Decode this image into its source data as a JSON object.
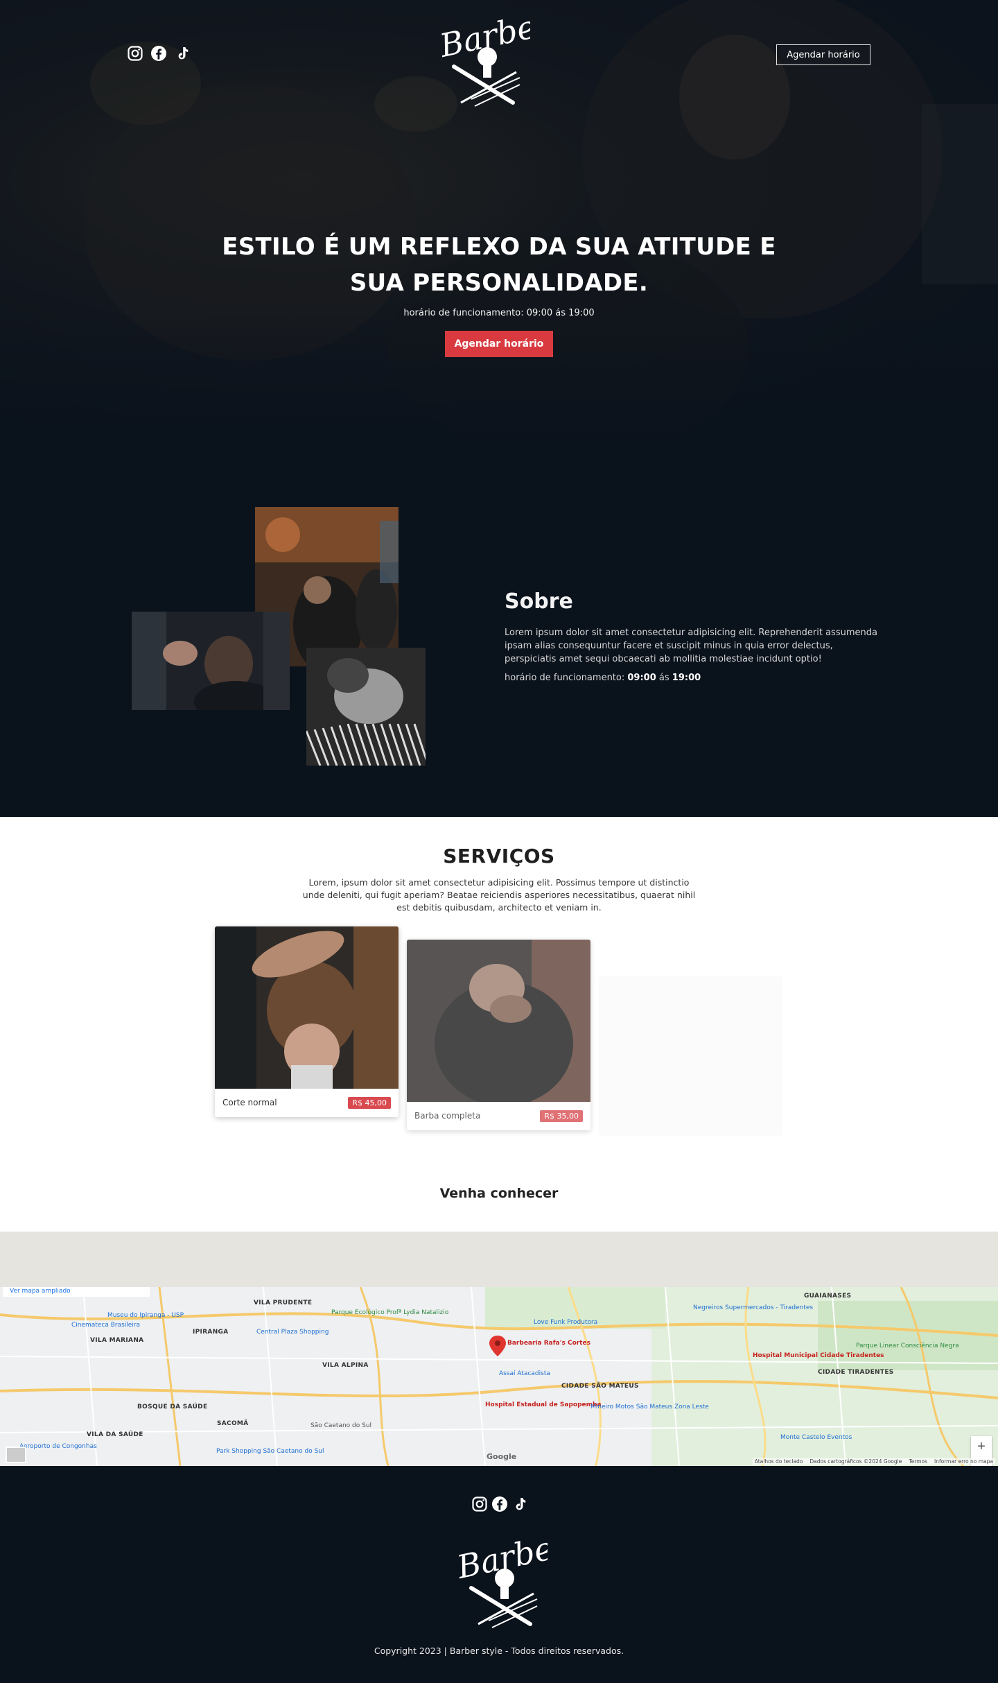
{
  "header": {
    "logo_text": "Barber",
    "cta_label": "Agendar horário",
    "socials": [
      "instagram-icon",
      "facebook-icon",
      "tiktok-icon"
    ]
  },
  "hero": {
    "title_line1": "ESTILO É UM REFLEXO DA SUA ATITUDE E",
    "title_line2": "SUA PERSONALIDADE.",
    "hours": "horário de funcionamento: 09:00 ás 19:00",
    "cta_label": "Agendar horário"
  },
  "about": {
    "title": "Sobre",
    "body": "Lorem ipsum dolor sit amet consectetur adipisicing elit. Reprehenderit assumenda ipsam alias consequuntur facere et suscipit minus in quia error delectus, perspiciatis amet sequi obcaecati ab mollitia molestiae incidunt optio!",
    "hours_prefix": "horário de funcionamento: ",
    "hours_open": "09:00",
    "hours_sep": " ás ",
    "hours_close": "19:00"
  },
  "services": {
    "title": "SERVIÇOS",
    "description": "Lorem, ipsum dolor sit amet consectetur adipisicing elit. Possimus tempore ut distinctio unde deleniti, qui fugit aperiam? Beatae reiciendis asperiores necessitatibus, quaerat nihil est debitis quibusdam, architecto et veniam in.",
    "items": [
      {
        "name": "Corte normal",
        "price": "R$ 45,00"
      },
      {
        "name": "Barba completa",
        "price": "R$ 35,00"
      }
    ]
  },
  "visit": {
    "title": "Venha conhecer"
  },
  "map": {
    "view_larger": "Ver mapa ampliado",
    "business": "Barbearia Rafa's Cortes",
    "labels": [
      {
        "text": "VILA PRUDENTE",
        "cls": "dark"
      },
      {
        "text": "IPIRANGA",
        "cls": "dark"
      },
      {
        "text": "VILA MARIANA",
        "cls": "dark"
      },
      {
        "text": "VILA ALPINA",
        "cls": "dark"
      },
      {
        "text": "CIDADE SÃO MATEUS",
        "cls": "dark"
      },
      {
        "text": "GUAIANASES",
        "cls": "dark"
      },
      {
        "text": "CIDADE TIRADENTES",
        "cls": "dark"
      },
      {
        "text": "BOSQUE DA SAÚDE",
        "cls": "dark"
      },
      {
        "text": "VILA DA SAÚDE",
        "cls": "dark"
      },
      {
        "text": "SACOMÃ",
        "cls": "dark"
      },
      {
        "text": "São Caetano do Sul",
        "cls": ""
      },
      {
        "text": "Museu do Ipiranga - USP",
        "cls": "blue"
      },
      {
        "text": "Cinemateca Brasileira",
        "cls": "blue"
      },
      {
        "text": "Parque Ecológico Profª Lydia Natalizio",
        "cls": "green"
      },
      {
        "text": "Central Plaza Shopping",
        "cls": "blue"
      },
      {
        "text": "Love Funk Produtora",
        "cls": "blue"
      },
      {
        "text": "Negreiros Supermercados - Tiradentes",
        "cls": "blue"
      },
      {
        "text": "Parque Linear Consciência Negra",
        "cls": "green"
      },
      {
        "text": "Hospital Municipal Cidade Tiradentes",
        "cls": "red"
      },
      {
        "text": "Assaí Atacadista",
        "cls": "blue"
      },
      {
        "text": "Hospital Estadual de Sapopemba",
        "cls": "red"
      },
      {
        "text": "Mineiro Motos São Mateus Zona Leste",
        "cls": "blue"
      },
      {
        "text": "Monte Castelo Eventos",
        "cls": "blue"
      },
      {
        "text": "Aeroporto de Congonhas",
        "cls": "blue"
      },
      {
        "text": "Park Shopping São Caetano do Sul",
        "cls": "blue"
      }
    ],
    "attribution": [
      "Atalhos do teclado",
      "Dados cartográficos ©2024 Google",
      "Termos",
      "Informar erro no mapa"
    ],
    "google": "Google",
    "zoom_in": "+",
    "zoom_out": "−"
  },
  "footer": {
    "logo_text": "Barber",
    "copyright": "Copyright 2023 | Barber style - Todos direitos reservados."
  },
  "colors": {
    "dark_bg": "#0a121c",
    "accent_red": "#d83a3f",
    "price_badge": "#d84a4f"
  }
}
